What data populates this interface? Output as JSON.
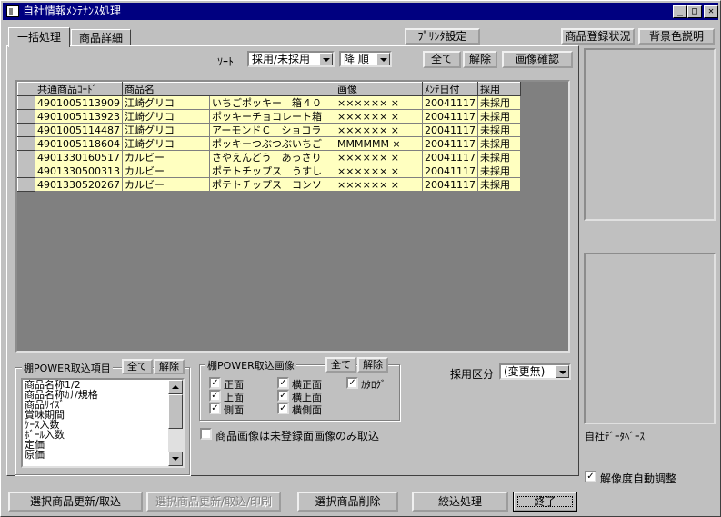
{
  "window": {
    "title": "自社情報ﾒﾝﾃﾅﾝｽ処理"
  },
  "tabs": [
    "一括処理",
    "商品詳細"
  ],
  "top_buttons": {
    "print_setup": "ﾌﾟﾘﾝﾀ設定",
    "registration_status": "商品登録状況",
    "bg_color_help": "背景色説明"
  },
  "sort": {
    "label": "ｿｰﾄ",
    "field": "採用/未採用",
    "order": "降 順"
  },
  "action_buttons": {
    "all": "全て",
    "release": "解除",
    "image_check": "画像確認"
  },
  "grid": {
    "columns": [
      "共通商品ｺｰﾄﾞ",
      "商品名",
      "画像",
      "ﾒﾝﾃ日付",
      "採用"
    ],
    "rows": [
      {
        "code": "4901005113909",
        "maker": "江崎グリコ",
        "name": "いちごポッキー　箱４０",
        "image": "×××××× ×",
        "date": "20041117",
        "status": "未採用"
      },
      {
        "code": "4901005113923",
        "maker": "江崎グリコ",
        "name": "ポッキーチョコレート箱",
        "image": "×××××× ×",
        "date": "20041117",
        "status": "未採用"
      },
      {
        "code": "4901005114487",
        "maker": "江崎グリコ",
        "name": "アーモンドＣ　ショコラ",
        "image": "×××××× ×",
        "date": "20041117",
        "status": "未採用"
      },
      {
        "code": "4901005118604",
        "maker": "江崎グリコ",
        "name": "ポッキーつぶつぶいちご",
        "image": "MMMMMM ×",
        "date": "20041117",
        "status": "未採用"
      },
      {
        "code": "4901330160517",
        "maker": "カルビー",
        "name": "さやえんどう　あっさり",
        "image": "×××××× ×",
        "date": "20041117",
        "status": "未採用"
      },
      {
        "code": "4901330500313",
        "maker": "カルビー",
        "name": "ポテトチップス　うすし",
        "image": "×××××× ×",
        "date": "20041117",
        "status": "未採用"
      },
      {
        "code": "4901330520267",
        "maker": "カルビー",
        "name": "ポテトチップス　コンソ",
        "image": "×××××× ×",
        "date": "20041117",
        "status": "未採用"
      }
    ]
  },
  "import_items": {
    "title": "棚POWER取込項目",
    "all": "全て",
    "release": "解除",
    "items": [
      "商品名称1/2",
      "商品名称ｶﾅ/規格",
      "商品ｻｲｽﾞ",
      "賞味期間",
      "ｹｰｽ入数",
      "ﾎﾞｰﾙ入数",
      "定価",
      "原価"
    ]
  },
  "import_images": {
    "title": "棚POWER取込画像",
    "all": "全て",
    "release": "解除",
    "col1": [
      "正面",
      "上面",
      "側面"
    ],
    "col2": [
      "横正面",
      "横上面",
      "横側面"
    ],
    "col3": [
      "ｶﾀﾛｸﾞ"
    ]
  },
  "unregistered_only": {
    "label": "商品画像は未登録面画像のみ取込",
    "checked": false
  },
  "adoption": {
    "label": "採用区分",
    "value": "(変更無)"
  },
  "side": {
    "db_label": "自社ﾃﾞｰﾀﾍﾞｰｽ",
    "auto_resolution": "解像度自動調整",
    "auto_checked": true
  },
  "bottom_buttons": {
    "update_import": "選択商品更新/取込",
    "update_import_print": "選択商品更新/取込/印刷",
    "delete": "選択商品削除",
    "filter": "絞込処理",
    "exit": "終了"
  },
  "colors": {
    "title_bar": "#000080",
    "grid_row": "#ffffc0",
    "face": "#c0c0c0",
    "grid_bg": "#808080"
  }
}
